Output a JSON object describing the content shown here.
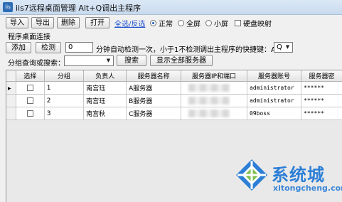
{
  "window": {
    "icon_text": "iis",
    "title": "iis7远程桌面管理 Alt+Q调出主程序"
  },
  "toolbar": {
    "import": "导入",
    "export": "导出",
    "delete": "删除",
    "open": "打开",
    "select_all": "全选/反选",
    "view_modes": [
      {
        "label": "正常",
        "selected": true
      },
      {
        "label": "全屏",
        "selected": false
      },
      {
        "label": "小屏",
        "selected": false
      }
    ],
    "disk_mapping": {
      "label": "硬盘映射",
      "checked": false
    }
  },
  "connect": {
    "section_label": "程序桌面连接",
    "add": "添加",
    "check": "检测",
    "interval_value": "0",
    "interval_text": "分钟自动检测一次，小于1不检测",
    "hotkey_label": "调出主程序的快捷键：Alt+",
    "hotkey_value": "Q"
  },
  "search": {
    "label": "分组查询或搜索：",
    "value": "",
    "search_button": "搜索",
    "show_all_button": "显示全部服务器"
  },
  "grid": {
    "columns": [
      "选择",
      "分组",
      "负责人",
      "服务器名称",
      "服务器IP和端口",
      "服务器账号",
      "服务器密"
    ],
    "rows": [
      {
        "group": "1",
        "owner": "南宫珏",
        "name": "A服务器",
        "ip": "",
        "account": "administrator",
        "password": "******",
        "current": true
      },
      {
        "group": "2",
        "owner": "南宫珏",
        "name": "B服务器",
        "ip": "",
        "account": "administrator",
        "password": "******",
        "current": false
      },
      {
        "group": "3",
        "owner": "南宫秋",
        "name": "C服务器",
        "ip": "",
        "account": "09boss",
        "password": "******",
        "current": false
      }
    ]
  },
  "watermark": {
    "name": "系统城",
    "url": "xitongcheng.com",
    "colors": {
      "blue": "#2d7fd6",
      "green": "#7cc04b"
    }
  }
}
